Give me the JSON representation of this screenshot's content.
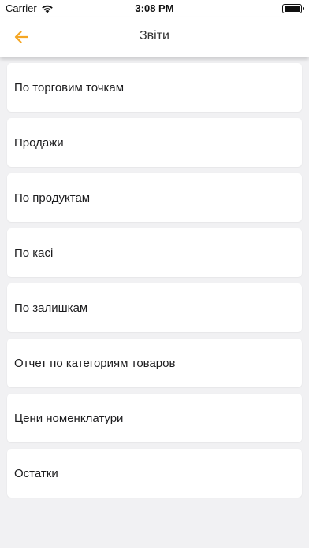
{
  "status_bar": {
    "carrier": "Carrier",
    "time": "3:08 PM"
  },
  "nav": {
    "title": "Звіти",
    "back_icon": "arrow-left-icon",
    "accent_color": "#f5a623"
  },
  "reports": [
    {
      "label": "По торговим точкам"
    },
    {
      "label": "Продажи"
    },
    {
      "label": "По продуктам"
    },
    {
      "label": "По касі"
    },
    {
      "label": "По залишкам"
    },
    {
      "label": "Отчет по категориям товаров"
    },
    {
      "label": "Цени номенклатури"
    },
    {
      "label": "Остатки"
    }
  ]
}
